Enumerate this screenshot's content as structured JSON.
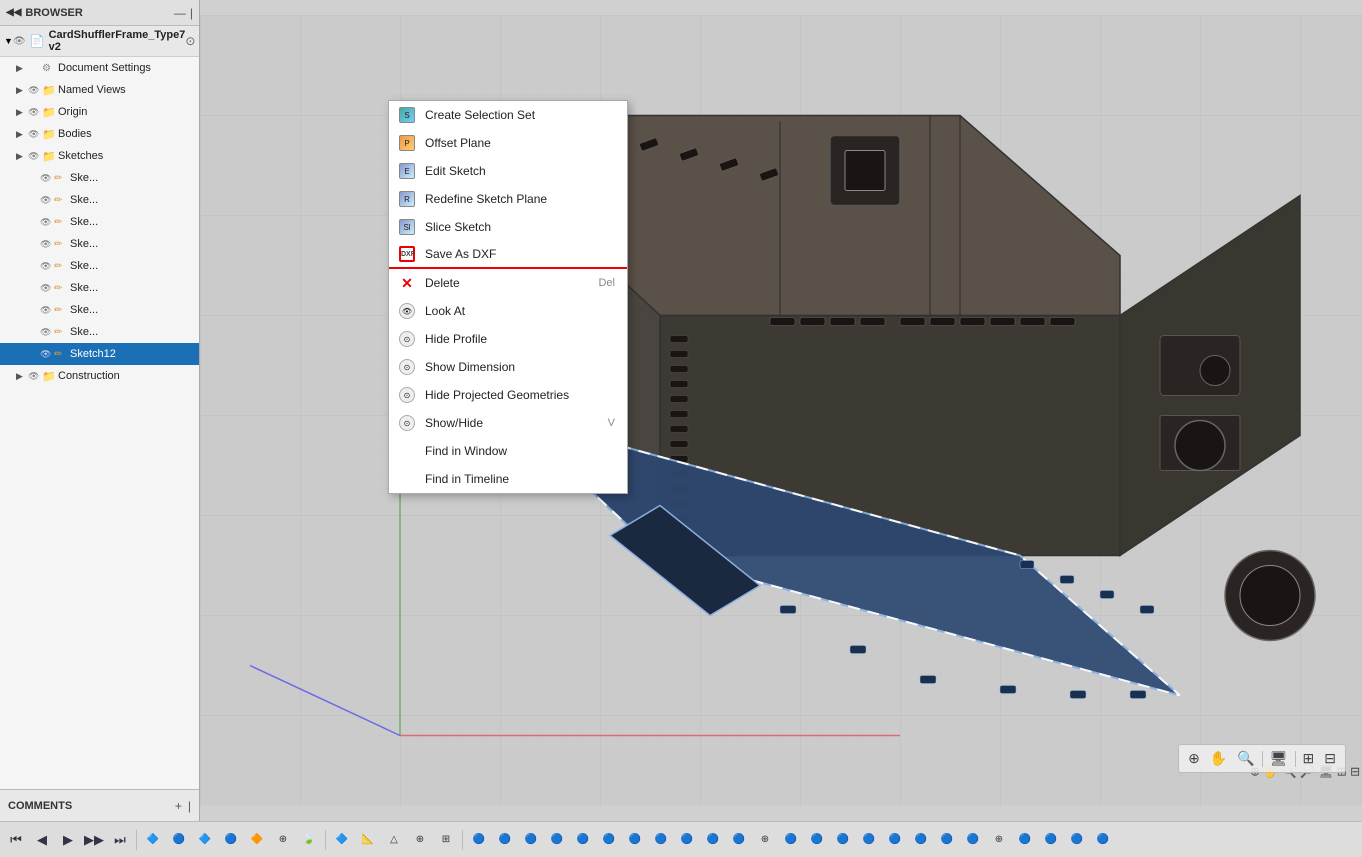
{
  "browser": {
    "title": "BROWSER",
    "document": {
      "name": "CardShufflerFrame_Type7 v2"
    },
    "tree": [
      {
        "id": "doc-settings",
        "label": "Document Settings",
        "indent": 1,
        "hasArrow": true,
        "hasEye": false,
        "type": "settings"
      },
      {
        "id": "named-views",
        "label": "Named Views",
        "indent": 1,
        "hasArrow": true,
        "hasEye": true,
        "type": "folder"
      },
      {
        "id": "origin",
        "label": "Origin",
        "indent": 1,
        "hasArrow": true,
        "hasEye": true,
        "type": "folder"
      },
      {
        "id": "bodies",
        "label": "Bodies",
        "indent": 1,
        "hasArrow": true,
        "hasEye": true,
        "type": "folder"
      },
      {
        "id": "sketches",
        "label": "Sketches",
        "indent": 1,
        "hasArrow": true,
        "hasEye": true,
        "type": "folder"
      },
      {
        "id": "sketch1",
        "label": "Ske...",
        "indent": 2,
        "hasArrow": false,
        "hasEye": true,
        "type": "sketch"
      },
      {
        "id": "sketch2",
        "label": "Ske...",
        "indent": 2,
        "hasArrow": false,
        "hasEye": true,
        "type": "sketch"
      },
      {
        "id": "sketch3",
        "label": "Ske...",
        "indent": 2,
        "hasArrow": false,
        "hasEye": true,
        "type": "sketch"
      },
      {
        "id": "sketch4",
        "label": "Ske...",
        "indent": 2,
        "hasArrow": false,
        "hasEye": true,
        "type": "sketch"
      },
      {
        "id": "sketch5",
        "label": "Ske...",
        "indent": 2,
        "hasArrow": false,
        "hasEye": true,
        "type": "sketch"
      },
      {
        "id": "sketch6",
        "label": "Ske...",
        "indent": 2,
        "hasArrow": false,
        "hasEye": true,
        "type": "sketch"
      },
      {
        "id": "sketch7",
        "label": "Ske...",
        "indent": 2,
        "hasArrow": false,
        "hasEye": true,
        "type": "sketch"
      },
      {
        "id": "sketch8",
        "label": "Ske...",
        "indent": 2,
        "hasArrow": false,
        "hasEye": true,
        "type": "sketch"
      },
      {
        "id": "sketch12",
        "label": "Sketch12",
        "indent": 2,
        "hasArrow": false,
        "hasEye": true,
        "type": "sketch",
        "selected": true
      },
      {
        "id": "construction",
        "label": "Construction",
        "indent": 1,
        "hasArrow": true,
        "hasEye": true,
        "type": "folder"
      }
    ]
  },
  "context_menu": {
    "items": [
      {
        "id": "create-selection-set",
        "label": "Create Selection Set",
        "icon": "selection-icon",
        "shortcut": "",
        "has_underline": false
      },
      {
        "id": "offset-plane",
        "label": "Offset Plane",
        "icon": "plane-icon",
        "shortcut": "",
        "has_underline": false
      },
      {
        "id": "edit-sketch",
        "label": "Edit Sketch",
        "icon": "edit-sketch-icon",
        "shortcut": "",
        "has_underline": false
      },
      {
        "id": "redefine-sketch-plane",
        "label": "Redefine Sketch Plane",
        "icon": "redefine-icon",
        "shortcut": "",
        "has_underline": false
      },
      {
        "id": "slice-sketch",
        "label": "Slice Sketch",
        "icon": "slice-icon",
        "shortcut": "",
        "has_underline": false
      },
      {
        "id": "save-as-dxf",
        "label": "Save As DXF",
        "icon": "dxf-icon",
        "shortcut": "",
        "has_underline": true
      },
      {
        "id": "delete",
        "label": "Delete",
        "icon": "delete-icon",
        "shortcut": "Del",
        "has_underline": false
      },
      {
        "id": "look-at",
        "label": "Look At",
        "icon": "lookat-icon",
        "shortcut": "",
        "has_underline": false
      },
      {
        "id": "hide-profile",
        "label": "Hide Profile",
        "icon": "hide-icon",
        "shortcut": "",
        "has_underline": false
      },
      {
        "id": "show-dimension",
        "label": "Show Dimension",
        "icon": "dimension-icon",
        "shortcut": "",
        "has_underline": false
      },
      {
        "id": "hide-projected-geometries",
        "label": "Hide Projected Geometries",
        "icon": "hideproj-icon",
        "shortcut": "",
        "has_underline": false
      },
      {
        "id": "show-hide",
        "label": "Show/Hide",
        "icon": "showhide-icon",
        "shortcut": "V",
        "has_underline": false
      },
      {
        "id": "find-in-window",
        "label": "Find in Window",
        "icon": "",
        "shortcut": "",
        "has_underline": false
      },
      {
        "id": "find-in-timeline",
        "label": "Find in Timeline",
        "icon": "",
        "shortcut": "",
        "has_underline": false
      }
    ]
  },
  "comments": {
    "title": "COMMENTS"
  },
  "toolbar": {
    "buttons": [
      "⏮",
      "◀",
      "▶",
      "▶▶",
      "⏭"
    ]
  }
}
